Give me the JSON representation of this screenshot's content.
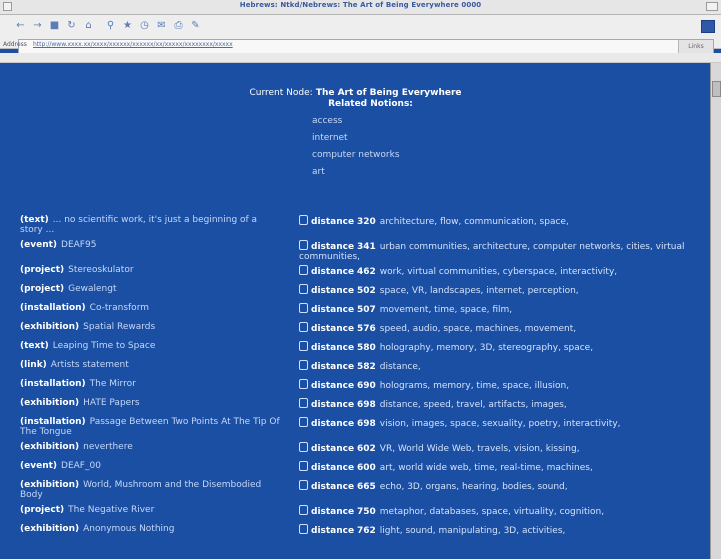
{
  "window": {
    "title": "Hebrews: Ntkd/Nebrews: The Art of Being Everywhere 0000"
  },
  "toolbar": {
    "icons": [
      "back-icon",
      "forward-icon",
      "stop-icon",
      "refresh-icon",
      "home-icon",
      "search-icon",
      "favorites-icon",
      "history-icon",
      "mail-icon",
      "print-icon",
      "edit-icon"
    ]
  },
  "address": {
    "label": "Address",
    "url": "http://www.xxxx.xx/xxxx/xxxxxx/xxxxxx/xx/xxxxx/xxxxxxxx/xxxxx",
    "go_label": "Links"
  },
  "page": {
    "current_node_label": "Current Node:",
    "current_node": "The Art of Being Everywhere",
    "related_label": "Related Notions:",
    "related": [
      "access",
      "internet",
      "computer networks",
      "art"
    ],
    "rows": [
      {
        "type": "(text)",
        "title": "... no scientific work, it's just a beginning of a story ...",
        "distance": "320",
        "keywords": "architecture, flow, communication, space,"
      },
      {
        "type": "(event)",
        "title": "DEAF95",
        "distance": "341",
        "keywords": "urban communities, architecture, computer networks, cities, virtual communities,"
      },
      {
        "type": "(project)",
        "title": "Stereoskulator",
        "distance": "462",
        "keywords": "work, virtual communities, cyberspace, interactivity,"
      },
      {
        "type": "(project)",
        "title": "Gewalengt",
        "distance": "502",
        "keywords": "space, VR, landscapes, internet, perception,"
      },
      {
        "type": "(installation)",
        "title": "Co-transform",
        "distance": "507",
        "keywords": "movement, time, space, film,"
      },
      {
        "type": "(exhibition)",
        "title": "Spatial Rewards",
        "distance": "576",
        "keywords": "speed, audio, space, machines, movement,"
      },
      {
        "type": "(text)",
        "title": "Leaping Time to Space",
        "distance": "580",
        "keywords": "holography, memory, 3D, stereography, space,"
      },
      {
        "type": "(link)",
        "title": "Artists statement",
        "distance": "582",
        "keywords": "distance,"
      },
      {
        "type": "(installation)",
        "title": "The Mirror",
        "distance": "690",
        "keywords": "holograms, memory, time, space, illusion,"
      },
      {
        "type": "(exhibition)",
        "title": "HATE Papers",
        "distance": "698",
        "keywords": "distance, speed, travel, artifacts, images,"
      },
      {
        "type": "(installation)",
        "title": "Passage Between Two Points At The Tip Of The Tongue",
        "distance": "698",
        "keywords": "vision, images, space, sexuality, poetry, interactivity,"
      },
      {
        "type": "(exhibition)",
        "title": "neverthere",
        "distance": "602",
        "keywords": "VR, World Wide Web, travels, vision, kissing,"
      },
      {
        "type": "(event)",
        "title": "DEAF_00",
        "distance": "600",
        "keywords": "art, world wide web, time, real-time, machines,"
      },
      {
        "type": "(exhibition)",
        "title": "World, Mushroom and the Disembodied Body",
        "distance": "665",
        "keywords": "echo, 3D, organs, hearing, bodies, sound,"
      },
      {
        "type": "(project)",
        "title": "The Negative River",
        "distance": "750",
        "keywords": "metaphor, databases, space, virtuality, cognition,"
      },
      {
        "type": "(exhibition)",
        "title": "Anonymous Nothing",
        "distance": "762",
        "keywords": "light, sound, manipulating, 3D, activities,"
      }
    ],
    "distance_label": "distance"
  }
}
